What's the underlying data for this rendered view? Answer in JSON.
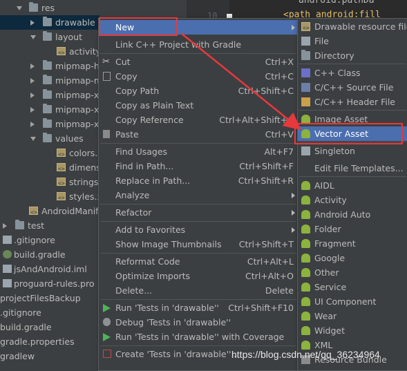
{
  "editor": {
    "line_number": "10",
    "code_line_1": "android:pathDa",
    "code_line_2": "<path android:fill"
  },
  "tree": {
    "items": [
      {
        "label": "res"
      },
      {
        "label": "drawable"
      },
      {
        "label": "layout"
      },
      {
        "label": "activity_"
      },
      {
        "label": "mipmap-h"
      },
      {
        "label": "mipmap-m"
      },
      {
        "label": "mipmap-xh"
      },
      {
        "label": "mipmap-xx"
      },
      {
        "label": "mipmap-xx"
      },
      {
        "label": "values"
      },
      {
        "label": "colors.x"
      },
      {
        "label": "dimens"
      },
      {
        "label": "strings.x"
      },
      {
        "label": "styles.x"
      },
      {
        "label": "AndroidManife"
      },
      {
        "label": "test"
      },
      {
        "label": ".gitignore"
      },
      {
        "label": "build.gradle"
      },
      {
        "label": "jsAndAndroid.iml"
      },
      {
        "label": "proguard-rules.pro"
      },
      {
        "label": "projectFilesBackup"
      },
      {
        "label": ".gitignore"
      },
      {
        "label": "build.gradle"
      },
      {
        "label": "gradle.properties"
      },
      {
        "label": "gradlew"
      }
    ]
  },
  "context_menu": {
    "items": [
      {
        "label": "New",
        "shortcut": ""
      },
      {
        "label": "Link C++ Project with Gradle",
        "shortcut": ""
      },
      {
        "label": "Cut",
        "shortcut": "Ctrl+X"
      },
      {
        "label": "Copy",
        "shortcut": "Ctrl+C"
      },
      {
        "label": "Copy Path",
        "shortcut": "Ctrl+Shift+C"
      },
      {
        "label": "Copy as Plain Text",
        "shortcut": ""
      },
      {
        "label": "Copy Reference",
        "shortcut": "Ctrl+Alt+Shift+C"
      },
      {
        "label": "Paste",
        "shortcut": "Ctrl+V"
      },
      {
        "label": "Find Usages",
        "shortcut": "Alt+F7"
      },
      {
        "label": "Find in Path...",
        "shortcut": "Ctrl+Shift+F"
      },
      {
        "label": "Replace in Path...",
        "shortcut": "Ctrl+Shift+R"
      },
      {
        "label": "Analyze",
        "shortcut": ""
      },
      {
        "label": "Refactor",
        "shortcut": ""
      },
      {
        "label": "Add to Favorites",
        "shortcut": ""
      },
      {
        "label": "Show Image Thumbnails",
        "shortcut": "Ctrl+Shift+T"
      },
      {
        "label": "Reformat Code",
        "shortcut": "Ctrl+Alt+L"
      },
      {
        "label": "Optimize Imports",
        "shortcut": "Ctrl+Alt+O"
      },
      {
        "label": "Delete...",
        "shortcut": "Delete"
      },
      {
        "label": "Run 'Tests in 'drawable''",
        "shortcut": "Ctrl+Shift+F10"
      },
      {
        "label": "Debug 'Tests in 'drawable''",
        "shortcut": ""
      },
      {
        "label": "Run 'Tests in 'drawable'' with Coverage",
        "shortcut": ""
      },
      {
        "label": "Create 'Tests in 'drawable''...",
        "shortcut": ""
      }
    ]
  },
  "new_submenu": {
    "items": [
      {
        "label": "Drawable resource file"
      },
      {
        "label": "File"
      },
      {
        "label": "Directory"
      },
      {
        "label": "C++ Class"
      },
      {
        "label": "C/C++ Source File"
      },
      {
        "label": "C/C++ Header File"
      },
      {
        "label": "Image Asset"
      },
      {
        "label": "Vector Asset"
      },
      {
        "label": "Singleton"
      },
      {
        "label": "Edit File Templates..."
      },
      {
        "label": "AIDL"
      },
      {
        "label": "Activity"
      },
      {
        "label": "Android Auto"
      },
      {
        "label": "Folder"
      },
      {
        "label": "Fragment"
      },
      {
        "label": "Google"
      },
      {
        "label": "Other"
      },
      {
        "label": "Service"
      },
      {
        "label": "UI Component"
      },
      {
        "label": "Wear"
      },
      {
        "label": "Widget"
      },
      {
        "label": "XML"
      },
      {
        "label": "Resource Bundle"
      }
    ]
  },
  "watermark": "https://blog.csdn.net/qq_36234964",
  "colors": {
    "highlight": "#4b6eaf",
    "annotation": "#e8383d",
    "background": "#3c3f41"
  }
}
